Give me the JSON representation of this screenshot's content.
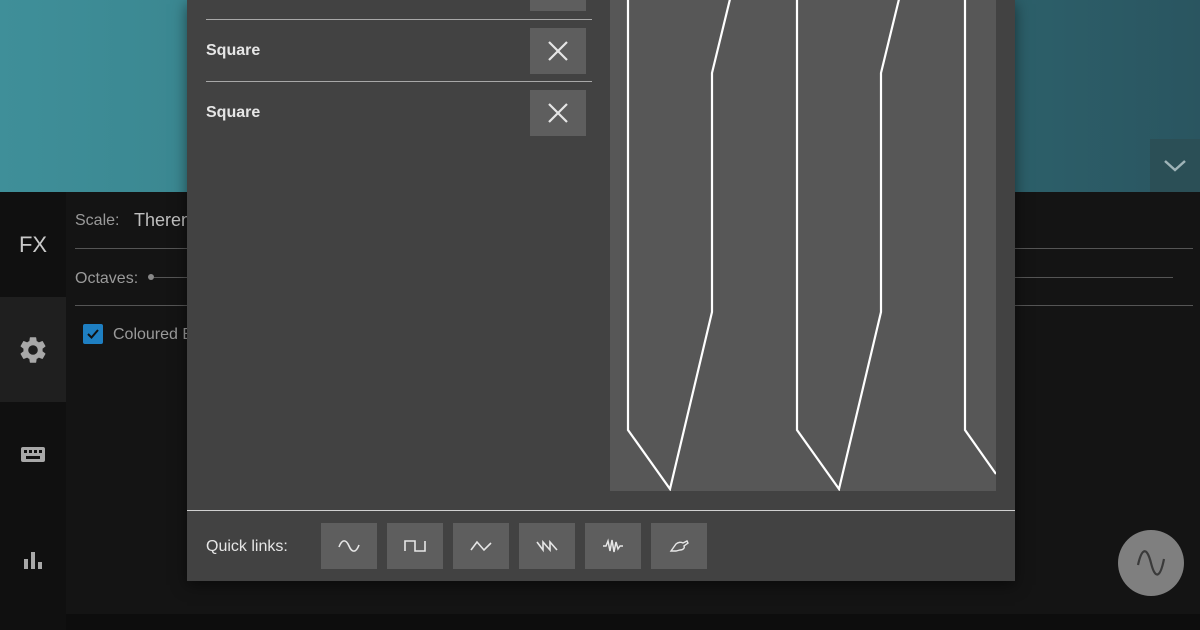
{
  "settings": {
    "scale_label": "Scale:",
    "scale_value": "Theren",
    "octaves_label": "Octaves:",
    "coloured_label": "Coloured B",
    "coloured_checked": true
  },
  "sidebar": {
    "fx_label": "FX",
    "active_item": "settings",
    "icons": [
      "settings-gear-icon",
      "keyboard-icon",
      "bar-chart-icon"
    ]
  },
  "dialog": {
    "waveforms": [
      {
        "label": "Square"
      },
      {
        "label": "Square"
      }
    ],
    "quick_links_label": "Quick links:",
    "quick_links": [
      "sine-wave-icon",
      "square-wave-icon",
      "triangle-wave-icon",
      "sawtooth-wave-icon",
      "noise-wave-icon",
      "draw-hand-icon"
    ]
  },
  "colors": {
    "accent": "#1e7fc2",
    "top_band": "#327780",
    "dialog_bg": "#424242",
    "preview_bg": "#575757"
  }
}
